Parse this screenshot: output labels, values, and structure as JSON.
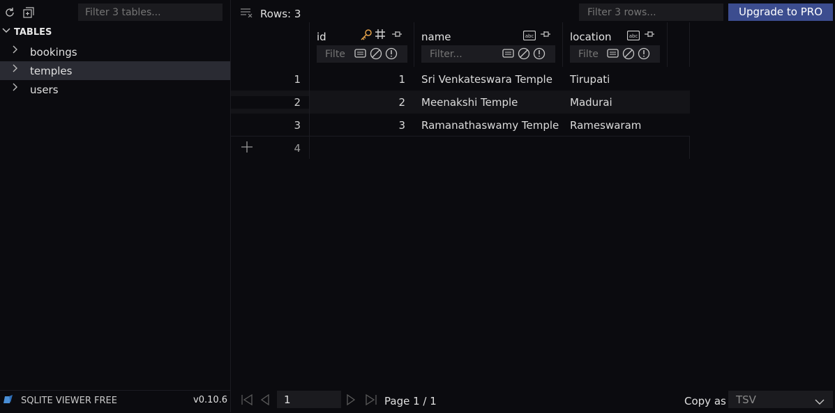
{
  "sidebar": {
    "filter_placeholder": "Filter 3 tables...",
    "section_label": "TABLES",
    "tables": [
      {
        "label": "bookings",
        "selected": false
      },
      {
        "label": "temples",
        "selected": true
      },
      {
        "label": "users",
        "selected": false
      }
    ],
    "footer": {
      "app_name": "SQLITE VIEWER FREE",
      "version": "v0.10.6"
    }
  },
  "toolbar": {
    "rows_label": "Rows: 3",
    "filter_rows_placeholder": "Filter 3 rows...",
    "upgrade_label": "Upgrade to PRO"
  },
  "columns": [
    {
      "name": "id",
      "filter_placeholder": "Filte",
      "type_icon": "hash-icon",
      "key_icon": "key-icon"
    },
    {
      "name": "name",
      "filter_placeholder": "Filter...",
      "type_icon": "abc-text-icon"
    },
    {
      "name": "location",
      "filter_placeholder": "Filte",
      "type_icon": "abc-text-icon"
    }
  ],
  "rows": [
    {
      "rownum": "1",
      "id": "1",
      "name": "Sri Venkateswara Temple",
      "location": "Tirupati"
    },
    {
      "rownum": "2",
      "id": "2",
      "name": "Meenakshi Temple",
      "location": "Madurai"
    },
    {
      "rownum": "3",
      "id": "3",
      "name": "Ramanathaswamy Temple",
      "location": "Rameswaram"
    }
  ],
  "new_row": {
    "rownum": "4"
  },
  "pagination": {
    "page_input": "1",
    "page_label": "Page 1 / 1"
  },
  "copy": {
    "label": "Copy as",
    "format": "TSV"
  },
  "colors": {
    "accent": "#3c4d8f",
    "key": "#e5a34a",
    "background": "#0b0b0f"
  }
}
